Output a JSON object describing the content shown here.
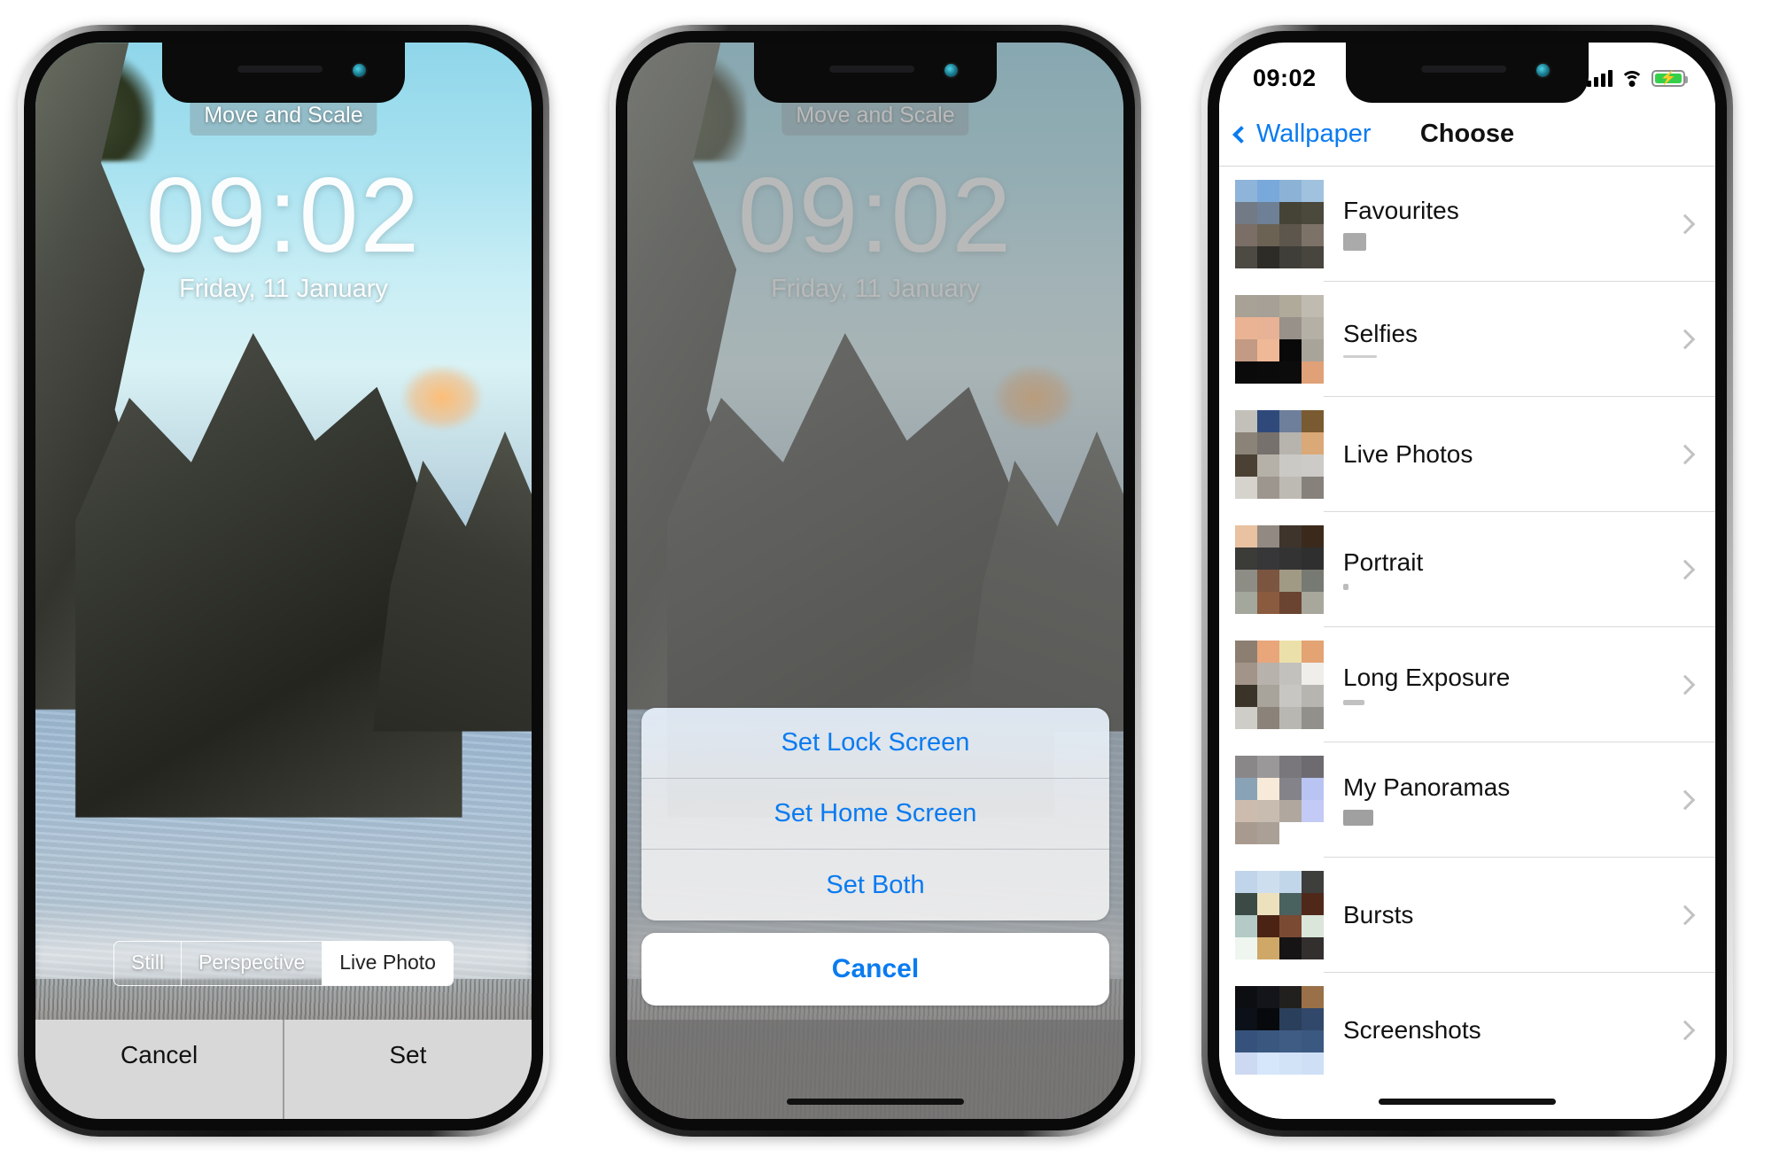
{
  "phone1": {
    "overlay_label": "Move and Scale",
    "clock": "09:02",
    "date": "Friday, 11 January",
    "segmented": [
      {
        "label": "Still",
        "selected": false
      },
      {
        "label": "Perspective",
        "selected": false
      },
      {
        "label": "Live Photo",
        "selected": true
      }
    ],
    "cancel_label": "Cancel",
    "set_label": "Set"
  },
  "phone2": {
    "overlay_label": "Move and Scale",
    "clock": "09:02",
    "date": "Friday, 11 January",
    "action_sheet": {
      "options": [
        {
          "label": "Set Lock Screen"
        },
        {
          "label": "Set Home Screen"
        },
        {
          "label": "Set Both"
        }
      ],
      "cancel_label": "Cancel"
    }
  },
  "phone3": {
    "status": {
      "time": "09:02",
      "signal_icon": "cellular-signal-icon",
      "wifi_icon": "wifi-icon",
      "battery_icon": "battery-charging-icon",
      "battery_color": "#35d04a"
    },
    "nav": {
      "back_label": "Wallpaper",
      "back_icon": "chevron-left-icon",
      "title": "Choose"
    },
    "albums": [
      {
        "title": "Favourites",
        "sub_style": "box",
        "thumb": [
          "#8fb4d9",
          "#79a9db",
          "#8cb3d6",
          "#a0c2de",
          "#717a85",
          "#6e8096",
          "#454336",
          "#4b483c",
          "#7a6e66",
          "#6b6254",
          "#5d564c",
          "#7d7267",
          "#4c4a42",
          "#2d2c27",
          "#3f3e38",
          "#47453d"
        ]
      },
      {
        "title": "Selfies",
        "sub_style": "line",
        "thumb": [
          "#a8a196",
          "#a6a096",
          "#b0aa9b",
          "#c0bbb0",
          "#eab394",
          "#e7b295",
          "#98918a",
          "#b5b0a6",
          "#c39a84",
          "#efb896",
          "#090909",
          "#a9a49a",
          "#0a0a0a",
          "#0b0b0b",
          "#0c0c0c",
          "#e0a179"
        ]
      },
      {
        "title": "Live Photos",
        "sub_style": "none",
        "thumb": [
          "#c3c0ba",
          "#2f4a7a",
          "#6d7f9b",
          "#7a5a31",
          "#8b8378",
          "#76716c",
          "#b7b4ae",
          "#dba878",
          "#4a4033",
          "#b5b0a8",
          "#cbc9c5",
          "#cdcbc7",
          "#d6d3cd",
          "#9d968e",
          "#bdbab4",
          "#86817b"
        ]
      },
      {
        "title": "Portrait",
        "sub_style": "dot",
        "thumb": [
          "#e8c2a1",
          "#928a82",
          "#3e342b",
          "#3b2a1b",
          "#3b3b38",
          "#37373a",
          "#333333",
          "#2f2f30",
          "#8e8d85",
          "#7b5540",
          "#a09a85",
          "#777a72",
          "#a4a79c",
          "#8a5b3f",
          "#6a4430",
          "#a7a79c"
        ]
      },
      {
        "title": "Long Exposure",
        "sub_style": "tiny",
        "thumb": [
          "#8c7f71",
          "#e8a67a",
          "#ece0aa",
          "#e3a372",
          "#a29489",
          "#b7b3ac",
          "#c3c1bd",
          "#efeeea",
          "#3a3327",
          "#a8a49c",
          "#c7c6c2",
          "#b7b5b0",
          "#cfcdc8",
          "#8b8379",
          "#b9b7b2",
          "#92908b"
        ]
      },
      {
        "title": "My Panoramas",
        "sub_style": "box2",
        "thumb": [
          "#8a8789",
          "#9b9899",
          "#79777c",
          "#6d6b70",
          "#8aa2b6",
          "#f7ead9",
          "#84838a",
          "#b9c4f2",
          "#cdbcae",
          "#c8bcb0",
          "#b0a89f",
          "#c2caf5",
          "#a89a8e",
          "#aaa096",
          "#ffffff",
          "#ffffff"
        ]
      },
      {
        "title": "Bursts",
        "sub_style": "none",
        "thumb": [
          "#c0d4ea",
          "#cddeef",
          "#c2d6ea",
          "#3e3e3c",
          "#3c4a45",
          "#ece0bd",
          "#49615f",
          "#50281a",
          "#b3cac6",
          "#4a2314",
          "#7a4a33",
          "#d9e6d9",
          "#eef6ef",
          "#cfa868",
          "#161414",
          "#332f2e"
        ]
      },
      {
        "title": "Screenshots",
        "sub_style": "none",
        "thumb": [
          "#0c0e12",
          "#14151a",
          "#22201e",
          "#9a7048",
          "#0c1018",
          "#08090c",
          "#2a3f5c",
          "#32486a",
          "#36527c",
          "#3a587f",
          "#3e5c84",
          "#3b5880",
          "#cdd9f2",
          "#d6e6fb",
          "#d2e3f8",
          "#cfe0f6"
        ]
      }
    ]
  }
}
